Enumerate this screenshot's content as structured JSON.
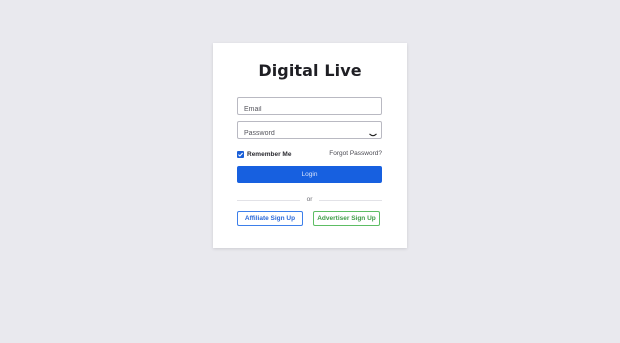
{
  "app": {
    "title": "Digital Live"
  },
  "form": {
    "email_placeholder": "Email",
    "password_placeholder": "Password",
    "remember_label": "Remember Me",
    "remember_checked": true,
    "forgot_label": "Forgot Password?",
    "login_label": "Login",
    "divider_text": "or",
    "affiliate_signup_label": "Affiliate Sign Up",
    "advertiser_signup_label": "Advertiser Sign Up"
  },
  "icons": {
    "password_toggle": "eye-closed-icon",
    "checkbox": "checkmark-icon"
  },
  "colors": {
    "primary": "#1760e0",
    "affiliate": "#3d7fea",
    "advertiser": "#5dbd64",
    "background": "#e9e9ee"
  }
}
